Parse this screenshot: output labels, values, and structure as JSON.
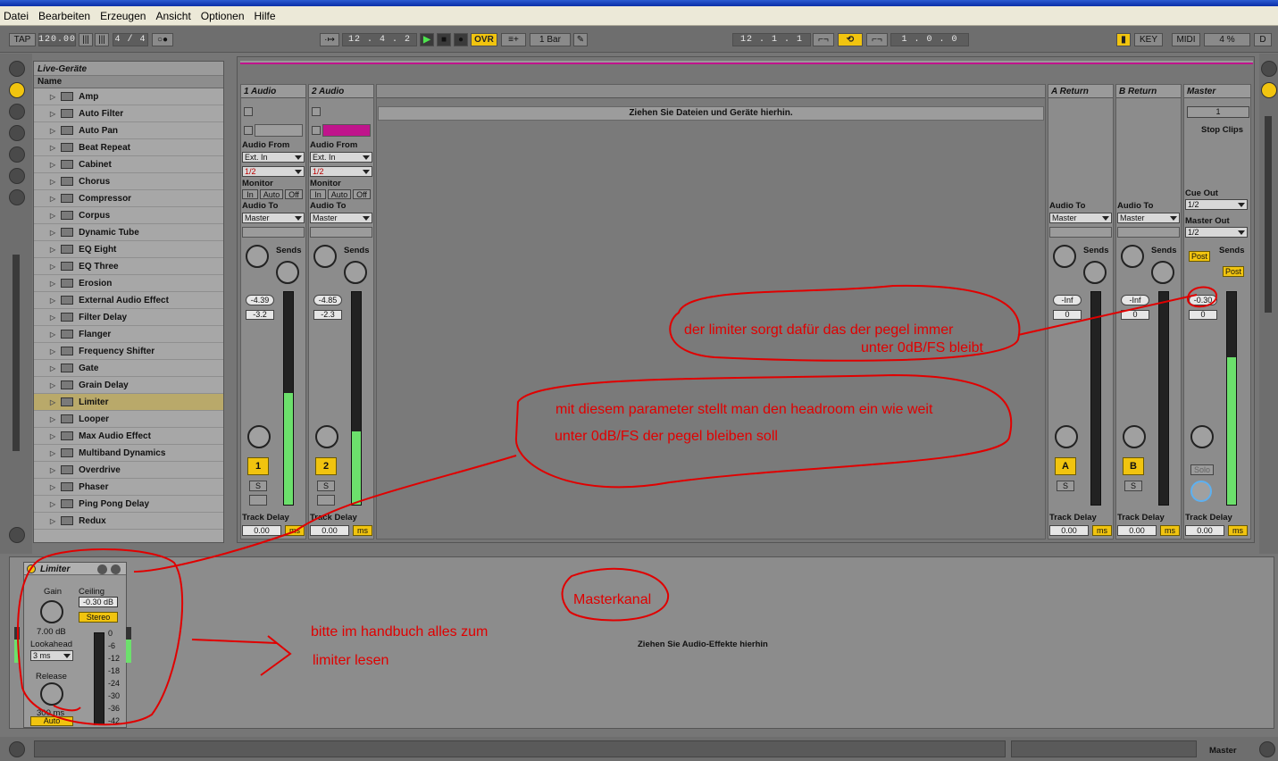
{
  "menu": [
    "Datei",
    "Bearbeiten",
    "Erzeugen",
    "Ansicht",
    "Optionen",
    "Hilfe"
  ],
  "transport": {
    "tap": "TAP",
    "tempo": "120.00",
    "sig": "4 / 4",
    "position": "12 .   4 .   2",
    "ovr": "OVR",
    "quant": "1 Bar",
    "loop_start": "12 .   1 .   1",
    "loop_len": "1 .   0 .   0",
    "key": "KEY",
    "midi": "MIDI",
    "cpu": "4 %",
    "d": "D"
  },
  "browser": {
    "title": "Live-Geräte",
    "column": "Name",
    "items": [
      "Amp",
      "Auto Filter",
      "Auto Pan",
      "Beat Repeat",
      "Cabinet",
      "Chorus",
      "Compressor",
      "Corpus",
      "Dynamic Tube",
      "EQ Eight",
      "EQ Three",
      "Erosion",
      "External Audio Effect",
      "Filter Delay",
      "Flanger",
      "Frequency Shifter",
      "Gate",
      "Grain Delay",
      "Limiter",
      "Looper",
      "Max Audio Effect",
      "Multiband Dynamics",
      "Overdrive",
      "Phaser",
      "Ping Pong Delay",
      "Redux"
    ],
    "selected": "Limiter"
  },
  "session": {
    "dropzone": "Ziehen Sie Dateien und Geräte hierhin.",
    "stop_clips": "Stop Clips",
    "scene": "1"
  },
  "labels": {
    "audio_from": "Audio From",
    "ext_in": "Ext. In",
    "half": "1/2",
    "monitor": "Monitor",
    "in": "In",
    "auto": "Auto",
    "off": "Off",
    "audio_to": "Audio To",
    "master": "Master",
    "sends": "Sends",
    "a": "A",
    "b": "B",
    "s": "S",
    "track_delay": "Track Delay",
    "delay_val": "0.00",
    "ms": "ms",
    "cue_out": "Cue Out",
    "master_out": "Master Out",
    "post": "Post",
    "solo": "Solo"
  },
  "tracks": [
    {
      "name": "1 Audio",
      "vol": "-4.39",
      "peak": "-3.2",
      "num": "1"
    },
    {
      "name": "2 Audio",
      "vol": "-4.85",
      "peak": "-2.3",
      "num": "2"
    }
  ],
  "returns": [
    {
      "name": "A Return",
      "vol": "-Inf",
      "peak": "0",
      "letter": "A"
    },
    {
      "name": "B Return",
      "vol": "-Inf",
      "peak": "0",
      "letter": "B"
    }
  ],
  "master": {
    "name": "Master",
    "vol": "-0.30",
    "peak": "0"
  },
  "device": {
    "name": "Limiter",
    "gain_label": "Gain",
    "gain": "7.00 dB",
    "ceiling_label": "Ceiling",
    "ceiling": "-0.30 dB",
    "stereo": "Stereo",
    "lookahead_label": "Lookahead",
    "lookahead": "3 ms",
    "release_label": "Release",
    "release": "300 ms",
    "auto": "Auto",
    "scale": [
      "0",
      "-6",
      "-12",
      "-18",
      "-24",
      "-30",
      "-36",
      "-42"
    ],
    "drop_hint": "Ziehen Sie Audio-Effekte hierhin"
  },
  "bottom": {
    "master": "Master"
  },
  "annotations": {
    "a1": "der limiter sorgt dafür das der pegel immer",
    "a2": "unter 0dB/FS bleibt",
    "b1": "mit diesem parameter stellt man den headroom ein wie weit",
    "b2": "unter 0dB/FS der pegel bleiben soll",
    "c1": "Masterkanal",
    "d1": "bitte im handbuch alles zum",
    "d2": "limiter lesen"
  },
  "colors": {
    "accent": "#f1c40f",
    "clip": "#c0148c",
    "annotation": "#e00000"
  }
}
